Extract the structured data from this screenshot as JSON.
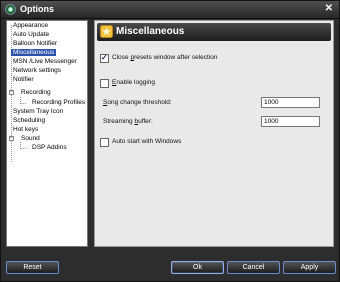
{
  "window": {
    "title": "Options",
    "close_glyph": "✕"
  },
  "nav": {
    "items": [
      {
        "label": "Appearance"
      },
      {
        "label": "Auto Update"
      },
      {
        "label": "Balloon Notifier"
      },
      {
        "label": "Miscellaneous",
        "selected": true
      },
      {
        "label": "MSN /Live Messenger"
      },
      {
        "label": "Network settings"
      },
      {
        "label": "Notifier"
      },
      {
        "label": "Recording",
        "expander": "−"
      },
      {
        "label": "Recording Profiles"
      },
      {
        "label": "System Tray Icon"
      },
      {
        "label": "Scheduling"
      },
      {
        "label": "Hot keys"
      },
      {
        "label": "Sound",
        "expander": "−"
      },
      {
        "label": "DSP Addins"
      }
    ]
  },
  "panel": {
    "title": "Miscellaneous",
    "close_presets": {
      "label_pre": "Close ",
      "label_key": "p",
      "label_post": "resets window after selection",
      "checked": true
    },
    "enable_logging": {
      "label_pre": "",
      "label_key": "E",
      "label_post": "nable logging",
      "checked": false
    },
    "song_change_threshold": {
      "label_pre": "",
      "label_key": "S",
      "label_post": "ong change threshold:",
      "value": "1000"
    },
    "streaming_buffer": {
      "label_pre": "Streaming ",
      "label_key": "b",
      "label_post": "uffer:",
      "value": "1000"
    },
    "auto_start": {
      "label": "Auto start with Windows",
      "checked": false
    }
  },
  "buttons": {
    "reset": "Reset",
    "ok": "Ok",
    "cancel": "Cancel",
    "apply": "Apply"
  },
  "colors": {
    "accent": "#2d52a9",
    "button_border": "#6a8bd0"
  }
}
